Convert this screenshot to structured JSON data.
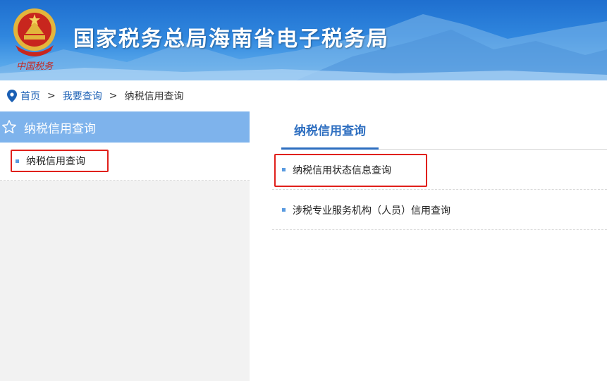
{
  "header": {
    "site_title": "国家税务总局海南省电子税务局",
    "emblem_icon": "tax-emblem-icon",
    "colors": {
      "banner_top": "#1f6fcf",
      "banner_bottom": "#7dbcf0"
    }
  },
  "breadcrumb": {
    "icon": "location-pin-icon",
    "items": [
      {
        "label": "首页"
      },
      {
        "label": "我要查询"
      },
      {
        "label": "纳税信用查询"
      }
    ],
    "separator": ">"
  },
  "sidebar": {
    "header_icon": "star-outline-icon",
    "header_label": "纳税信用查询",
    "items": [
      {
        "label": "纳税信用查询",
        "highlighted": true
      }
    ],
    "colors": {
      "header_bg": "#7eb3ec",
      "highlight_border": "#e0201b"
    }
  },
  "main": {
    "tabs": [
      {
        "label": "纳税信用查询",
        "active": true
      }
    ],
    "links": [
      {
        "label": "纳税信用状态信息查询",
        "highlighted": true
      },
      {
        "label": "涉税专业服务机构（人员）信用查询",
        "highlighted": false
      }
    ],
    "colors": {
      "tab_active": "#2d6ec0",
      "bullet": "#5a9be0"
    }
  }
}
